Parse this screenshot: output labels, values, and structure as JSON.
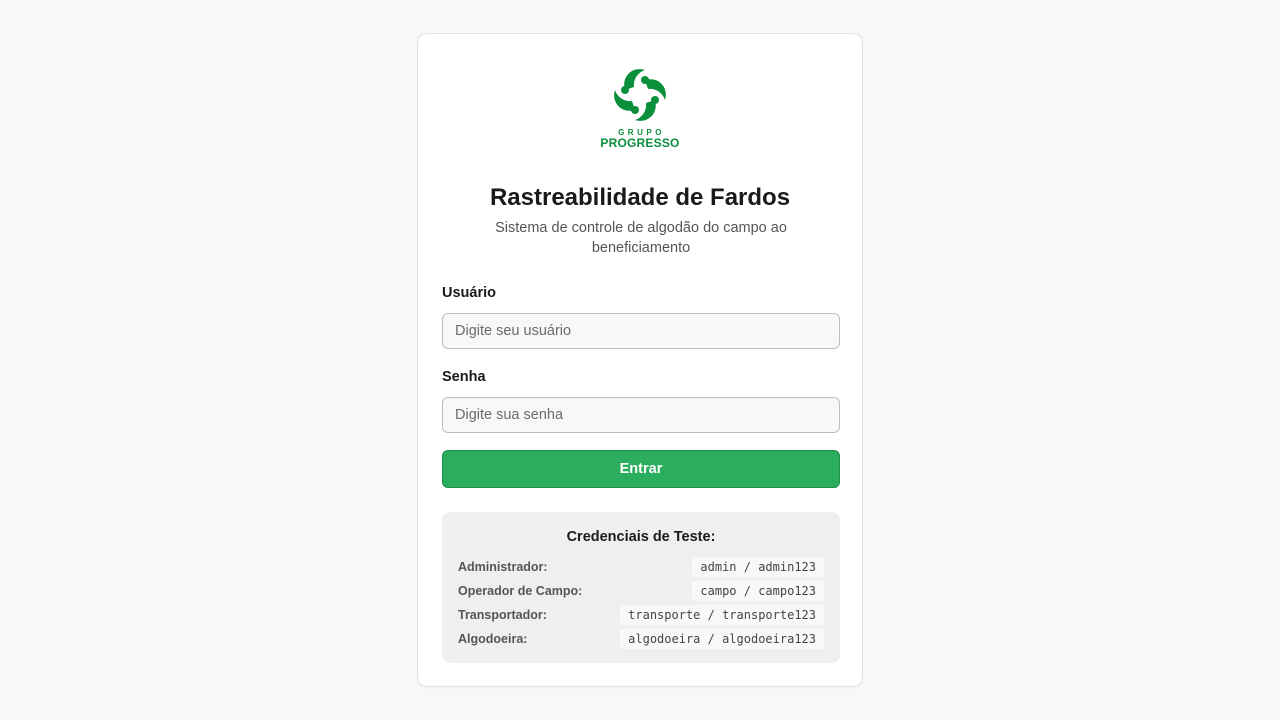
{
  "brand": {
    "logo_small": "GRUPO",
    "logo_big": "PROGRESSO",
    "color": "#0a8f3a"
  },
  "header": {
    "title": "Rastreabilidade de Fardos",
    "subtitle": "Sistema de controle de algodão do campo ao beneficiamento"
  },
  "form": {
    "username_label": "Usuário",
    "username_placeholder": "Digite seu usuário",
    "password_label": "Senha",
    "password_placeholder": "Digite sua senha",
    "submit_label": "Entrar",
    "accent_color": "#2aad5d"
  },
  "credentials": {
    "title": "Credenciais de Teste:",
    "items": [
      {
        "role": "Administrador:",
        "value": "admin / admin123"
      },
      {
        "role": "Operador de Campo:",
        "value": "campo / campo123"
      },
      {
        "role": "Transportador:",
        "value": "transporte / transporte123"
      },
      {
        "role": "Algodoeira:",
        "value": "algodoeira / algodoeira123"
      }
    ]
  }
}
